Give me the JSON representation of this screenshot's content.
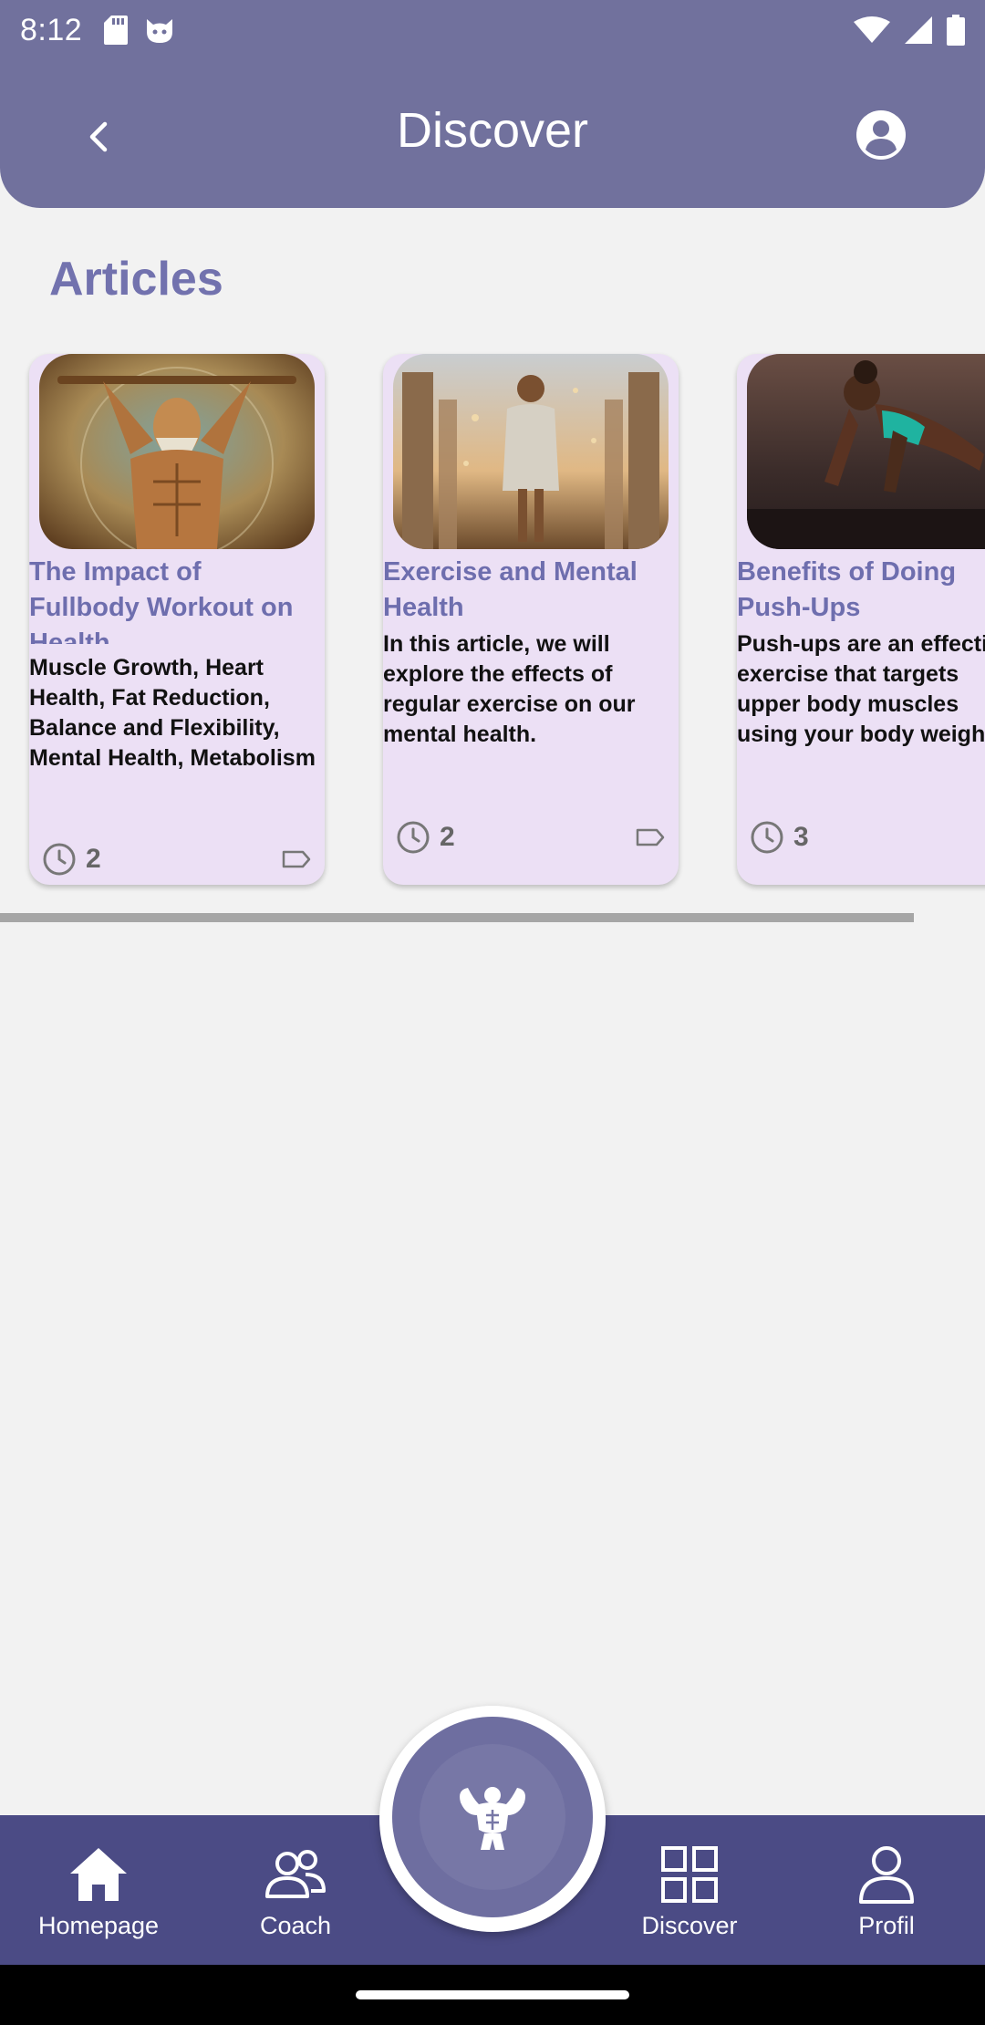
{
  "status_bar": {
    "time": "8:12"
  },
  "app_bar": {
    "title": "Discover"
  },
  "section": {
    "title": "Articles"
  },
  "articles": [
    {
      "title": "The Impact of Fullbody Workout on Health",
      "description": "Muscle Growth, Heart Health, Fat Reduction, Balance and Flexibility, Mental Health, Metabolism Rate",
      "read_time": "2"
    },
    {
      "title": "Exercise and Mental Health",
      "description": "In this article, we will explore the effects of regular exercise on our mental health.",
      "read_time": "2"
    },
    {
      "title": "Benefits of Doing Push-Ups",
      "description": "Push-ups are an effective exercise that targets upper body muscles using your body weight.",
      "read_time": "3"
    }
  ],
  "bottom_nav": {
    "items": [
      {
        "label": "Homepage",
        "icon": "home-icon"
      },
      {
        "label": "Coach",
        "icon": "coach-icon"
      },
      {
        "label": "Discover",
        "icon": "grid-icon"
      },
      {
        "label": "Profil",
        "icon": "person-icon"
      }
    ]
  },
  "colors": {
    "header": "#71719d",
    "accent_text": "#7272ae",
    "card_bg": "#ece0f5",
    "nav_bg": "#4b4b85"
  }
}
